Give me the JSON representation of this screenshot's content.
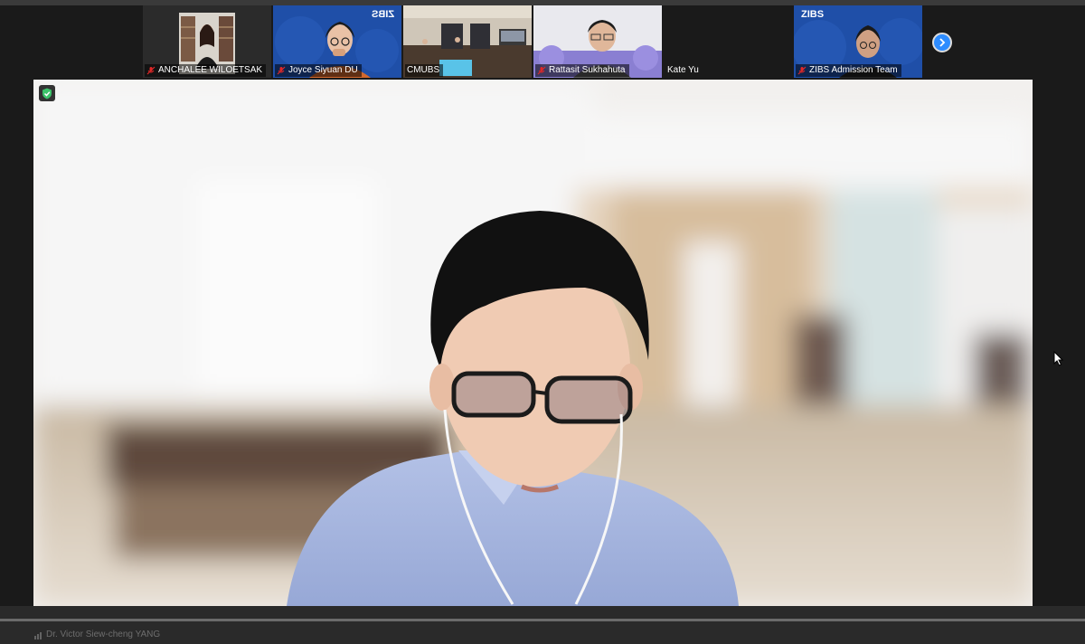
{
  "gallery": {
    "tiles": [
      {
        "name": "ANCHALEE WILOETSAK",
        "muted": true
      },
      {
        "name": "Joyce Siyuan DU",
        "muted": true,
        "banner": "ZIBS"
      },
      {
        "name": "CMUBS",
        "muted": false
      },
      {
        "name": "Rattasit Sukhahuta",
        "muted": true
      },
      {
        "name": "Kate Yu",
        "muted": false
      },
      {
        "name": "ZIBS Admission Team",
        "muted": true,
        "banner": "ZIBS"
      }
    ],
    "next_icon": "chevron-right-icon"
  },
  "main_video": {
    "security_icon": "shield-check-icon",
    "speaker_label": "Dr. Victor Siew-cheng YANG"
  },
  "colors": {
    "accent": "#2d8cff",
    "muted_red": "#e02828",
    "shield_green": "#3cc36a"
  }
}
